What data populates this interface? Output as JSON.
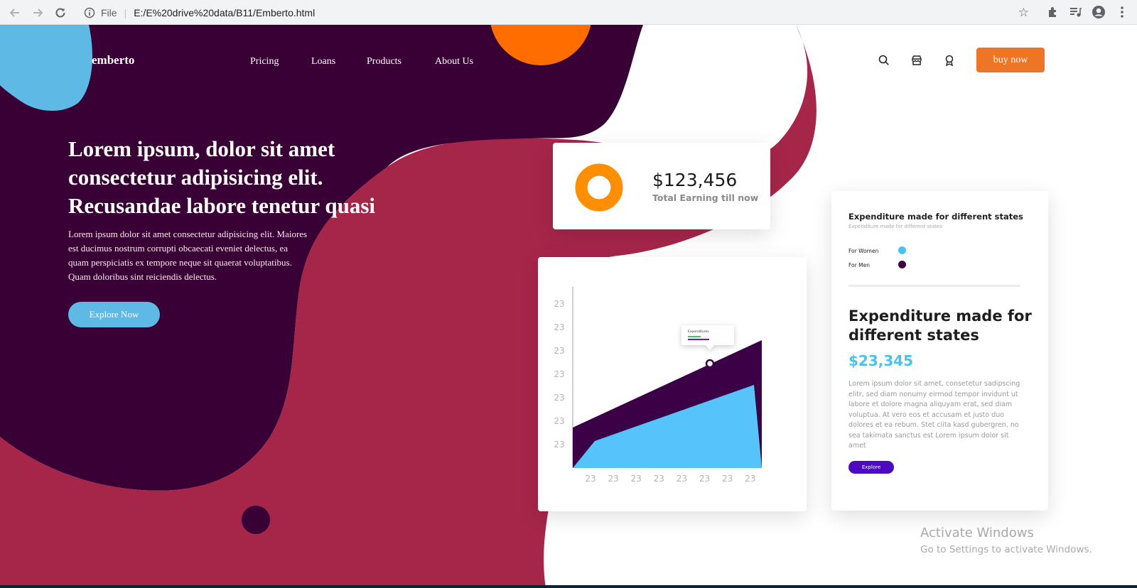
{
  "browser": {
    "scheme": "File",
    "url": "E:/E%20drive%20data/B11/Emberto.html",
    "icons": [
      "back-icon",
      "forward-icon",
      "reload-icon",
      "info-icon",
      "star-icon",
      "extensions-icon",
      "reading-list-icon",
      "profile-icon",
      "menu-icon"
    ]
  },
  "header": {
    "logo": "emberto",
    "nav": [
      "Pricing",
      "Loans",
      "Products",
      "About Us"
    ],
    "icons": [
      "search-icon",
      "store-icon",
      "award-icon"
    ],
    "buy_label": "buy now"
  },
  "hero": {
    "title": "Lorem ipsum, dolor sit amet consectetur adipisicing elit. Recusandae labore tenetur quasi",
    "text": "Lorem ipsum dolor sit amet consectetur adipisicing elit. Maiores est ducimus nostrum corrupti obcaecati eveniet delectus, ea quam perspiciatis ex tempore neque sit quaerat voluptatibus. Quam doloribus sint reiciendis delectus.",
    "button": "Explore Now"
  },
  "earnings": {
    "value": "$123,456",
    "label": "Total Earning till now"
  },
  "chart_data": {
    "type": "area",
    "y_tick_labels": [
      "23",
      "23",
      "23",
      "23",
      "23",
      "23",
      "23"
    ],
    "x_tick_labels": [
      "23",
      "23",
      "23",
      "23",
      "23",
      "23",
      "23",
      "23"
    ],
    "tooltip_title": "Expenditures",
    "colors": {
      "back": "#3b0045",
      "front": "#56c3fa"
    }
  },
  "side_card": {
    "title": "Expenditure made for different states",
    "subtitle": "Expenditure made for different states",
    "legend": [
      {
        "label": "For Women",
        "color": "#4dc1ee"
      },
      {
        "label": "For Men",
        "color": "#3b0045"
      }
    ],
    "big_title": "Expenditure made for different states",
    "amount": "$23,345",
    "paragraph": "Lorem ipsum dolor sit amet, consetetur sadipscing elitr, sed diam nonumy eirmod tempor invidunt ut labore et dolore magna aliquyam erat, sed diam voluptua. At vero eos et accusam et justo duo dolores et ea rebum. Stet clita kasd gubergren, no sea takimata sanctus est Lorem ipsum dolor sit amet",
    "button": "Explore"
  },
  "watermark": {
    "line1": "Activate Windows",
    "line2": "Go to Settings to activate Windows."
  },
  "colors": {
    "dark_purple": "#380035",
    "crimson": "#a6264a",
    "orange": "#ff6c00",
    "sky": "#5fb9e5",
    "buy": "#ec7625"
  }
}
